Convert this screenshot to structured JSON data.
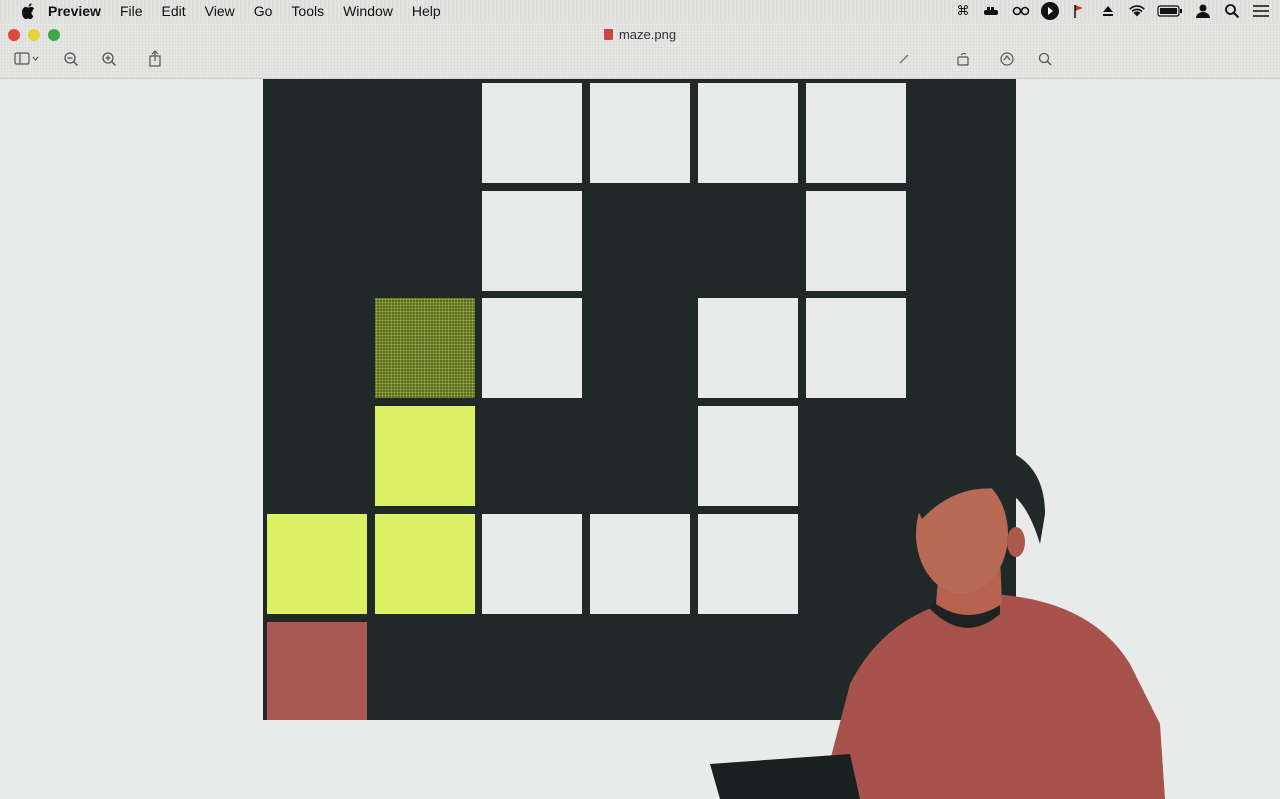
{
  "menubar": {
    "app_name": "Preview",
    "items": [
      "File",
      "Edit",
      "View",
      "Go",
      "Tools",
      "Window",
      "Help"
    ],
    "status_icons": [
      "command-icon",
      "docker-icon",
      "glasses-icon",
      "play-icon",
      "flag-icon",
      "eject-icon",
      "wifi-icon",
      "battery-icon",
      "user-icon",
      "spotlight-search-icon",
      "notification-center-icon"
    ]
  },
  "window": {
    "title": "maze.png",
    "toolbar": [
      "sidebar-toggle-icon",
      "zoom-out-icon",
      "zoom-in-icon",
      "share-icon",
      "markup-pen-icon",
      "rotate-icon",
      "annotate-icon",
      "search-icon"
    ]
  },
  "maze": {
    "rows": 6,
    "cols": 7,
    "colors": {
      "wall": "#202928",
      "open": "#e8eae9",
      "path": "#dcf064",
      "current": "#5c6c26",
      "start": "#a95752"
    },
    "cells": [
      {
        "row": 0,
        "col": 2,
        "state": "open"
      },
      {
        "row": 0,
        "col": 3,
        "state": "open"
      },
      {
        "row": 0,
        "col": 4,
        "state": "open"
      },
      {
        "row": 0,
        "col": 5,
        "state": "open"
      },
      {
        "row": 1,
        "col": 2,
        "state": "open"
      },
      {
        "row": 1,
        "col": 5,
        "state": "open"
      },
      {
        "row": 2,
        "col": 1,
        "state": "current"
      },
      {
        "row": 2,
        "col": 2,
        "state": "open"
      },
      {
        "row": 2,
        "col": 4,
        "state": "open"
      },
      {
        "row": 2,
        "col": 5,
        "state": "open"
      },
      {
        "row": 3,
        "col": 1,
        "state": "path"
      },
      {
        "row": 3,
        "col": 4,
        "state": "open"
      },
      {
        "row": 4,
        "col": 0,
        "state": "path"
      },
      {
        "row": 4,
        "col": 1,
        "state": "path"
      },
      {
        "row": 4,
        "col": 2,
        "state": "open"
      },
      {
        "row": 4,
        "col": 3,
        "state": "open"
      },
      {
        "row": 4,
        "col": 4,
        "state": "open"
      },
      {
        "row": 5,
        "col": 0,
        "state": "start"
      }
    ]
  }
}
